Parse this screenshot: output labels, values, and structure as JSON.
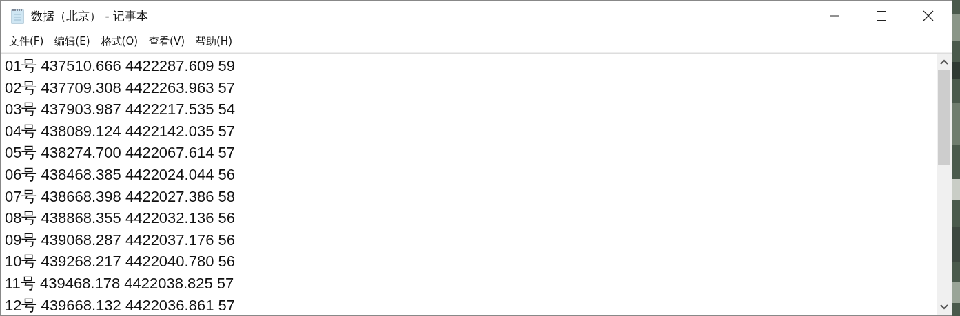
{
  "window": {
    "title": "数据（北京） - 记事本"
  },
  "menu": [
    "文件(F)",
    "编辑(E)",
    "格式(O)",
    "查看(V)",
    "帮助(H)"
  ],
  "lines": [
    "01号 437510.666 4422287.609 59",
    "02号 437709.308 4422263.963 57",
    "03号 437903.987 4422217.535 54",
    "04号 438089.124 4422142.035 57",
    "05号 438274.700 4422067.614 57",
    "06号 438468.385 4422024.044 56",
    "07号 438668.398 4422027.386 58",
    "08号 438868.355 4422032.136 56",
    "09号 439068.287 4422037.176 56",
    "10号 439268.217 4422040.780 56",
    "11号 439468.178 4422038.825 57",
    "12号 439668.132 4422036.861 57"
  ]
}
